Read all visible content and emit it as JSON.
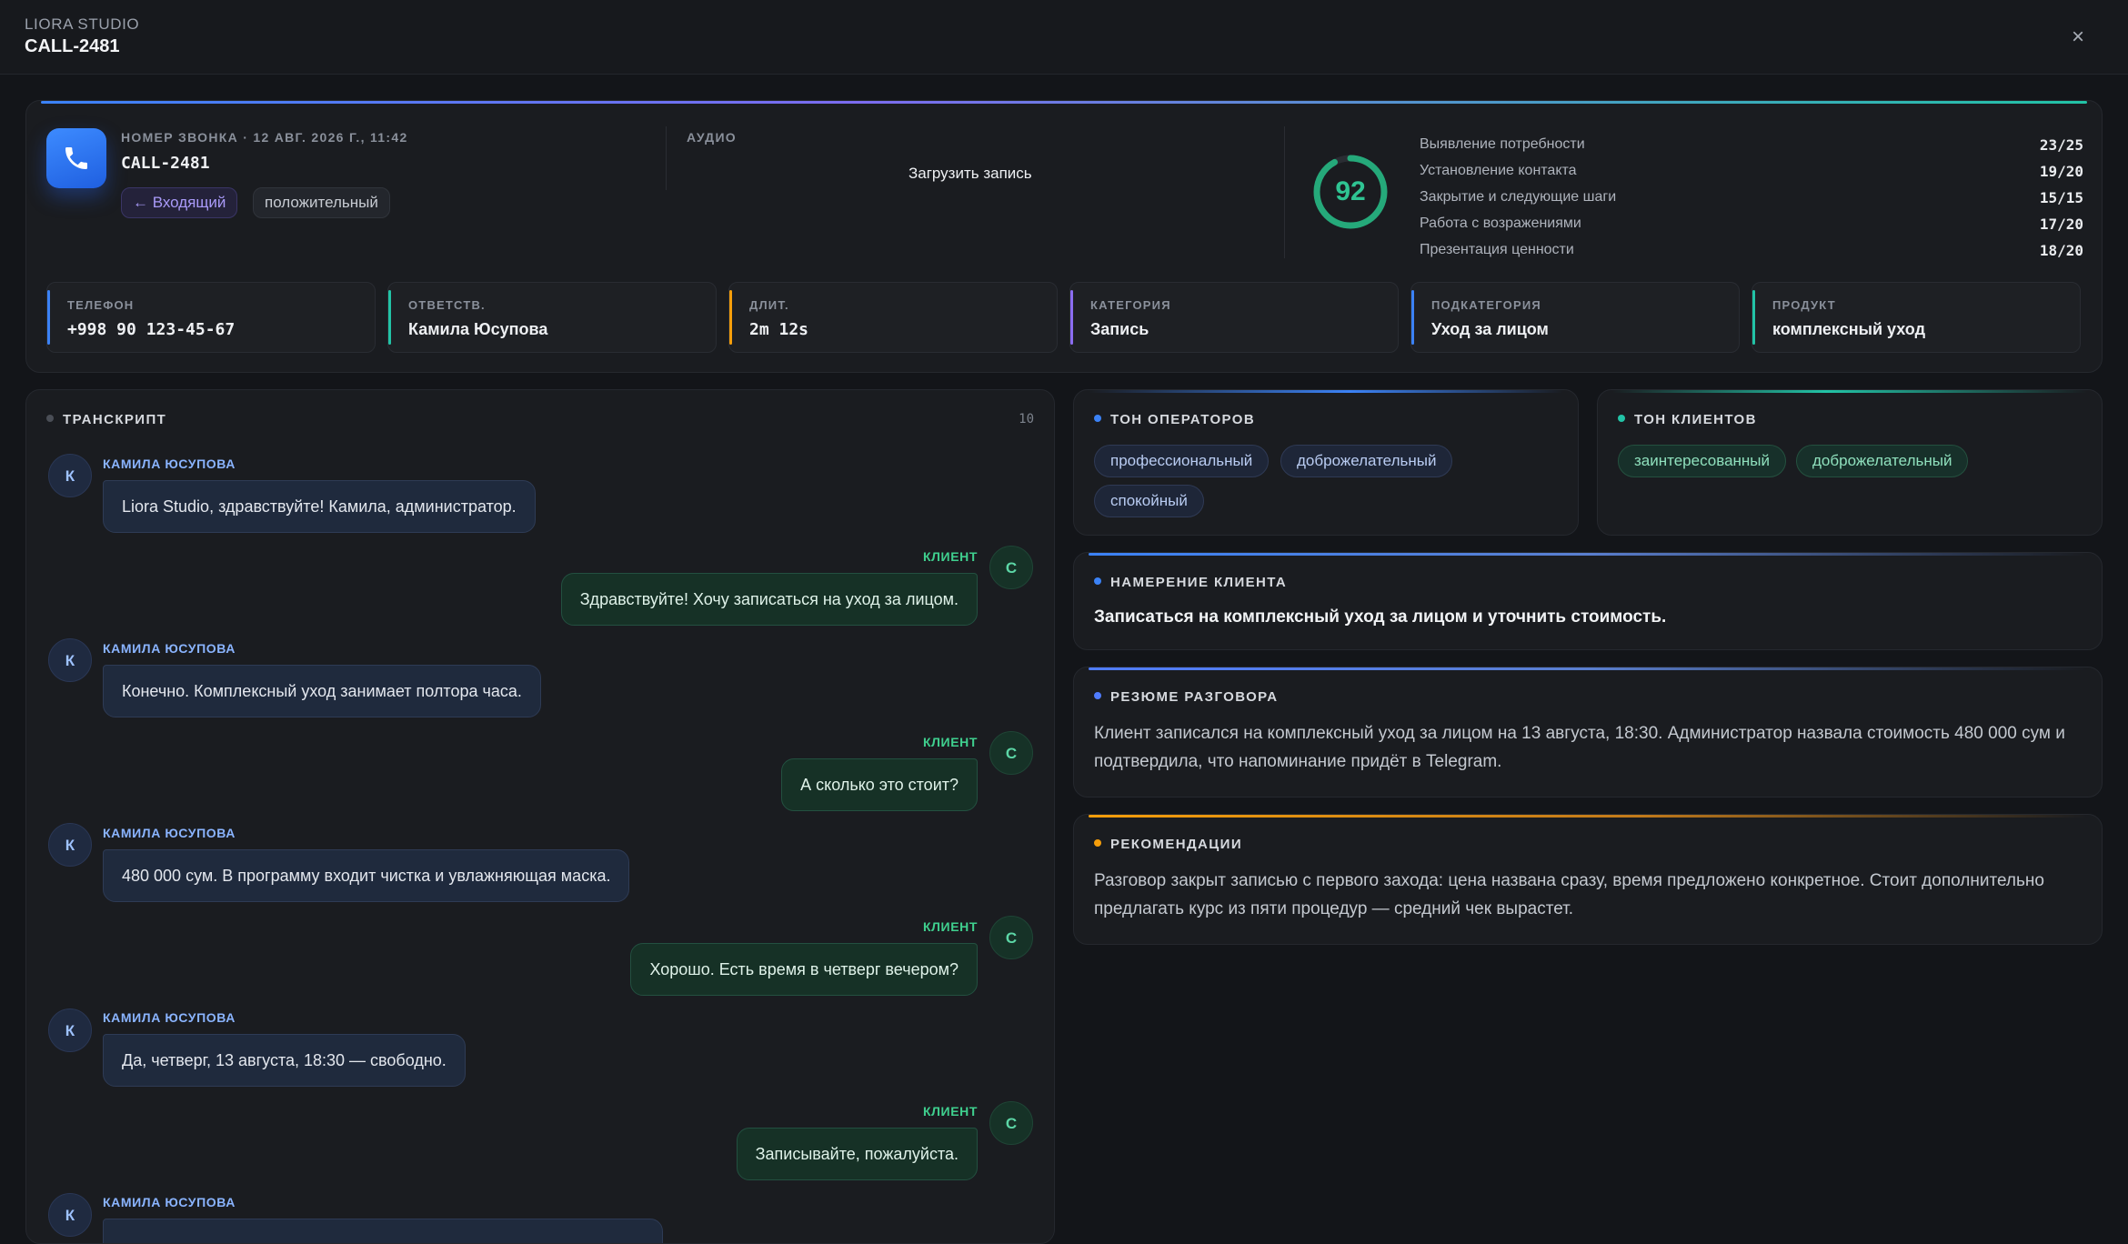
{
  "topbar": {
    "brand": "LIORA STUDIO",
    "title": "CALL-2481",
    "close": "×"
  },
  "header": {
    "meta_label": "НОМЕР ЗВОНКА · 12 АВГ. 2026 Г., 11:42",
    "call_id": "CALL-2481",
    "direction": "← Входящий",
    "sentiment": "положительный",
    "audio_label": "АУДИО",
    "upload_label": "Загрузить запись",
    "score": "92",
    "score_fraction": 0.92,
    "criteria": [
      {
        "name": "Выявление потребности",
        "value": "23/25"
      },
      {
        "name": "Установление контакта",
        "value": "19/20"
      },
      {
        "name": "Закрытие и следующие шаги",
        "value": "15/15"
      },
      {
        "name": "Работа с возражениями",
        "value": "17/20"
      },
      {
        "name": "Презентация ценности",
        "value": "18/20"
      }
    ],
    "fields": [
      {
        "label": "ТЕЛЕФОН",
        "value": "+998 90 123-45-67",
        "color": "#3b82f6"
      },
      {
        "label": "ОТВЕТСТВ.",
        "value": "Камила Юсупова",
        "color": "#22c3a6"
      },
      {
        "label": "ДЛИТ.",
        "value": "2m 12s",
        "color": "#f59e0b"
      },
      {
        "label": "КАТЕГОРИЯ",
        "value": "Запись",
        "color": "#8b6cf0"
      },
      {
        "label": "ПОДКАТЕГОРИЯ",
        "value": "Уход за лицом",
        "color": "#3b82f6"
      },
      {
        "label": "ПРОДУКТ",
        "value": "комплексный уход",
        "color": "#22c3a6"
      }
    ]
  },
  "transcript": {
    "title": "ТРАНСКРИПТ",
    "count": "10",
    "operator_initial": "К",
    "client_initial": "С",
    "operator_name": "КАМИЛА ЮСУПОВА",
    "client_name": "КЛИЕНТ",
    "messages": [
      {
        "role": "op",
        "text": "Liora Studio, здравствуйте! Камила, администратор."
      },
      {
        "role": "cl",
        "text": "Здравствуйте! Хочу записаться на уход за лицом."
      },
      {
        "role": "op",
        "text": "Конечно. Комплексный уход занимает полтора часа."
      },
      {
        "role": "cl",
        "text": "А сколько это стоит?"
      },
      {
        "role": "op",
        "text": "480 000 сум. В программу входит чистка и увлажняющая маска."
      },
      {
        "role": "cl",
        "text": "Хорошо. Есть время в четверг вечером?"
      },
      {
        "role": "op",
        "text": "Да, четверг, 13 августа, 18:30 — свободно."
      },
      {
        "role": "cl",
        "text": "Записывайте, пожалуйста."
      },
      {
        "role": "op",
        "text": ""
      }
    ]
  },
  "operator_tone": {
    "title": "ТОН ОПЕРАТОРОВ",
    "tags": [
      "профессиональный",
      "доброжелательный",
      "спокойный"
    ]
  },
  "client_tone": {
    "title": "ТОН КЛИЕНТОВ",
    "tags": [
      "заинтересованный",
      "доброжелательный"
    ]
  },
  "intent": {
    "title": "НАМЕРЕНИЕ КЛИЕНТА",
    "text": "Записаться на комплексный уход за лицом и уточнить стоимость."
  },
  "summary": {
    "title": "РЕЗЮМЕ РАЗГОВОРА",
    "text": "Клиент записался на комплексный уход за лицом на 13 августа, 18:30. Администратор назвала стоимость 480 000 сум и подтвердила, что напоминание придёт в Telegram."
  },
  "recommendations": {
    "title": "РЕКОМЕНДАЦИИ",
    "text": "Разговор закрыт записью с первого захода: цена названа сразу, время предложено конкретное. Стоит дополнительно предлагать курс из пяти процедур — средний чек вырастет."
  },
  "colors": {
    "accent_blue": "#3b82f6",
    "accent_green": "#2fc493",
    "accent_orange": "#f59e0b",
    "accent_purple": "#8b6cf0"
  }
}
